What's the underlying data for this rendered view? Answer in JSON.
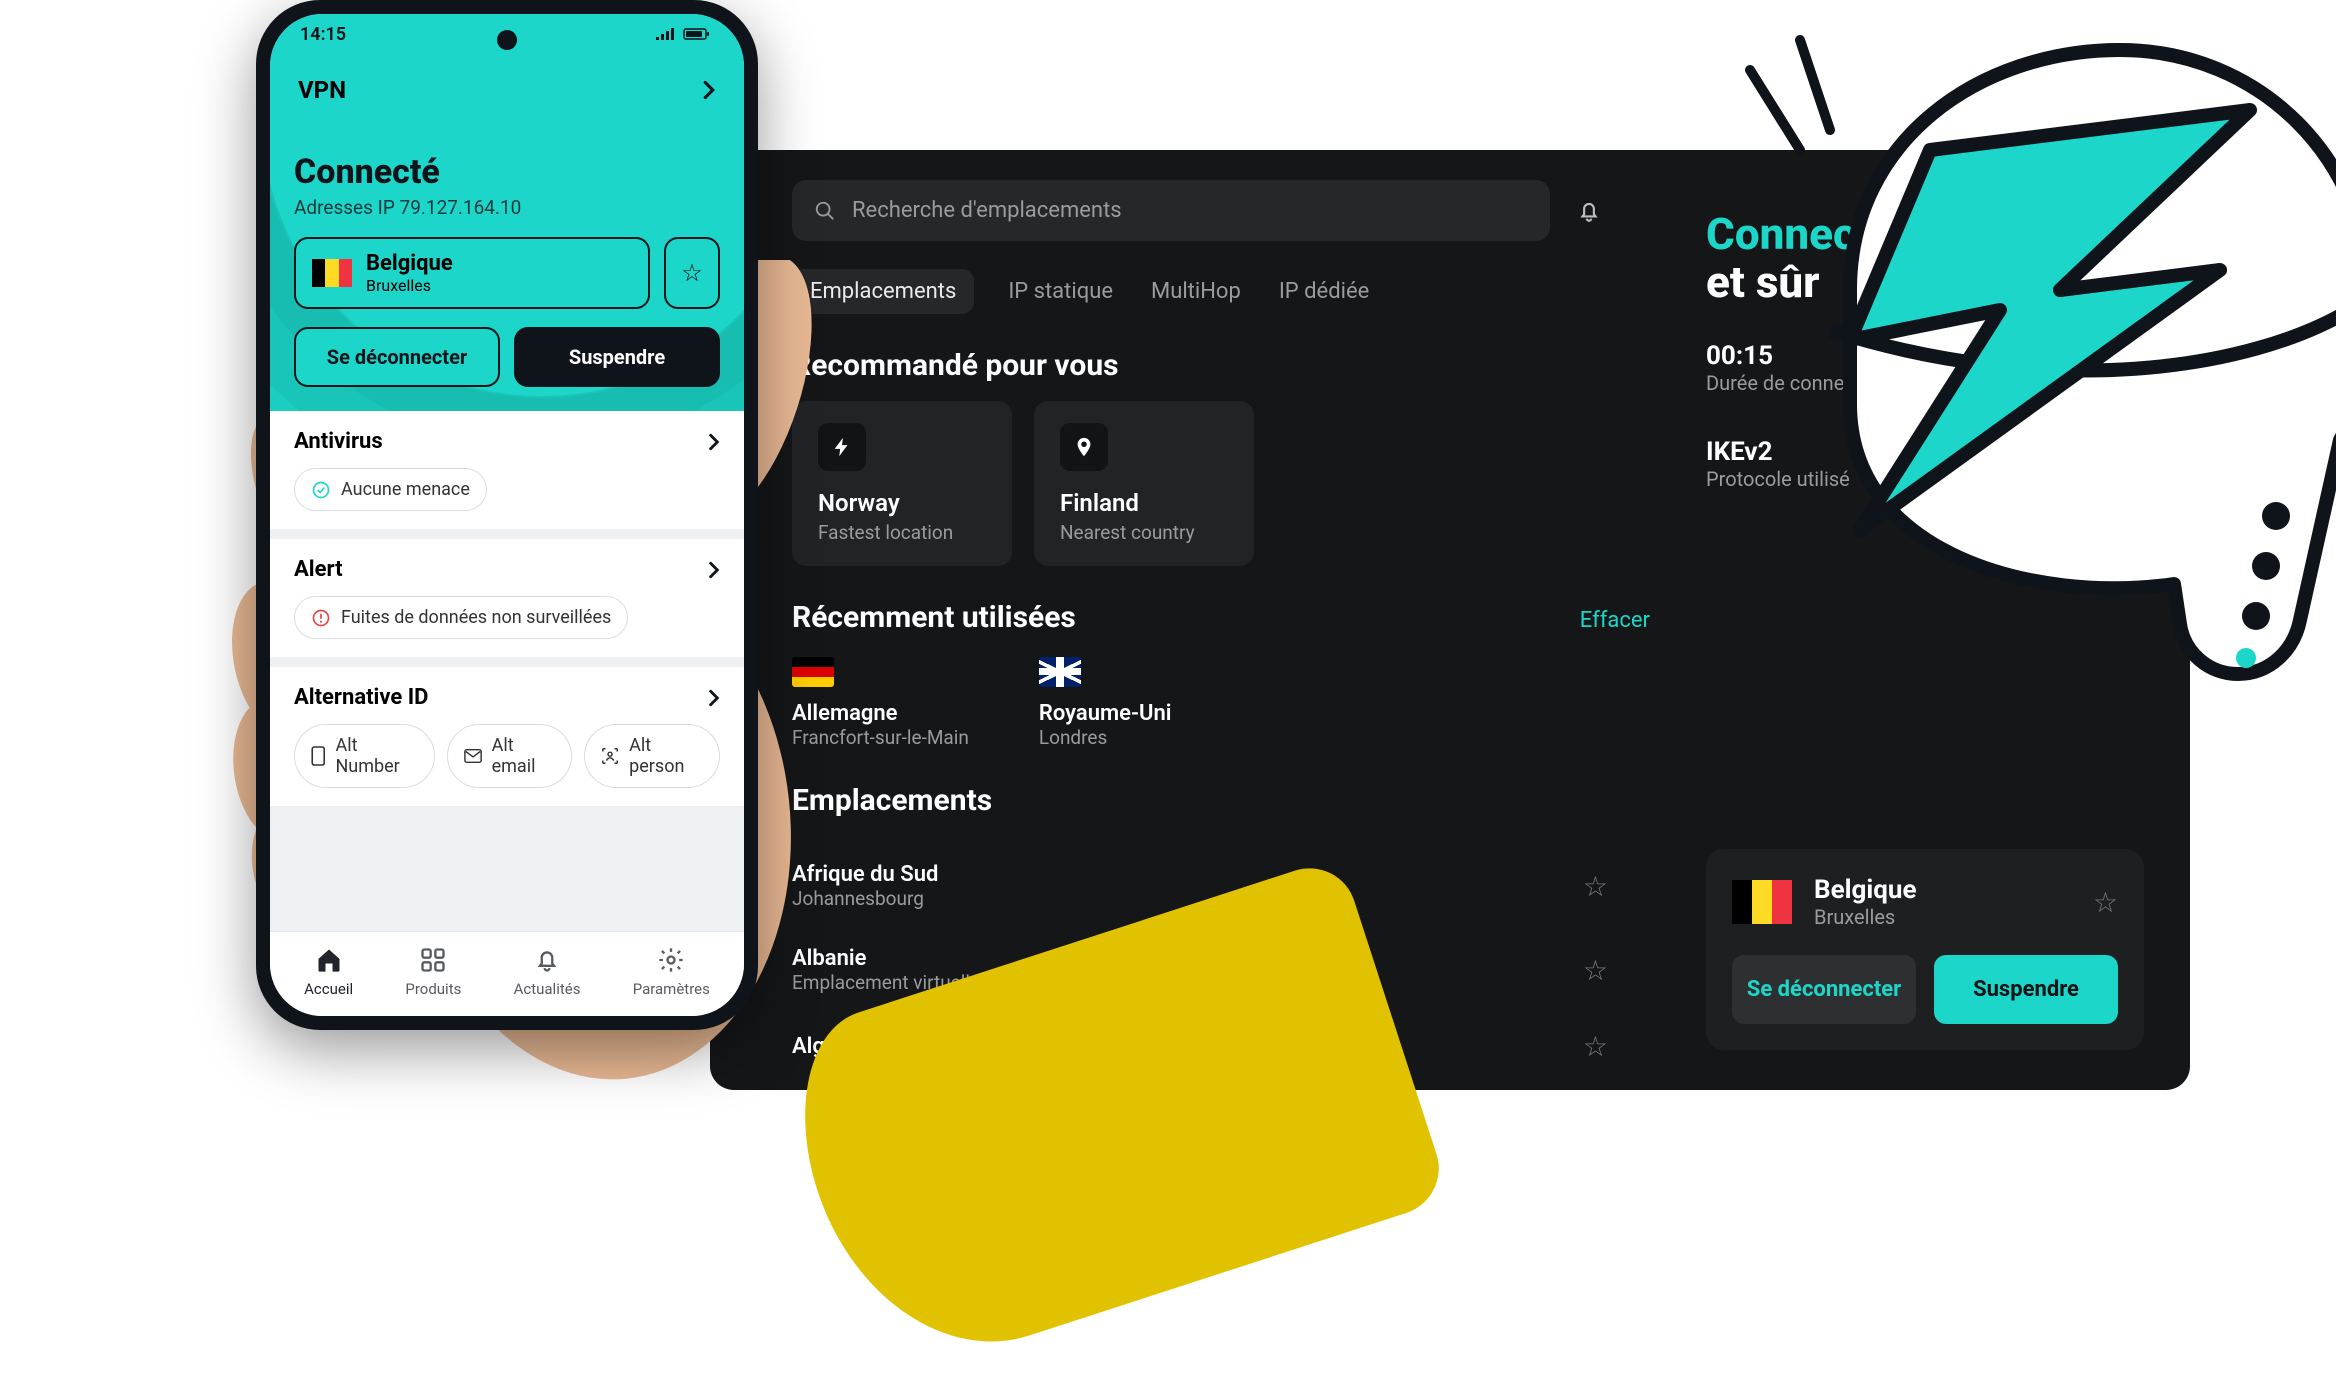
{
  "phone": {
    "time": "14:15",
    "app_selector": "VPN",
    "status": "Connecté",
    "ip_label": "Adresses IP 79.127.164.10",
    "server": {
      "country": "Belgique",
      "city": "Bruxelles"
    },
    "disconnect": "Se déconnecter",
    "suspend": "Suspendre",
    "sections": {
      "antivirus": {
        "title": "Antivirus",
        "status": "Aucune menace"
      },
      "alert": {
        "title": "Alert",
        "status": "Fuites de données non surveillées"
      },
      "altid": {
        "title": "Alternative ID",
        "pills": [
          "Alt Number",
          "Alt email",
          "Alt person"
        ]
      }
    },
    "tabs": [
      "Accueil",
      "Produits",
      "Actualités",
      "Paramètres"
    ]
  },
  "desktop": {
    "search_placeholder": "Recherche d'emplacements",
    "tabs": [
      "Emplacements",
      "IP statique",
      "MultiHop",
      "IP dédiée"
    ],
    "recommended_title": "Recommandé pour vous",
    "recommended": [
      {
        "title": "Norway",
        "sub": "Fastest location",
        "icon": "bolt"
      },
      {
        "title": "Finland",
        "sub": "Nearest country",
        "icon": "pin"
      }
    ],
    "recent_title": "Récemment utilisées",
    "clear": "Effacer",
    "recent": [
      {
        "country": "Allemagne",
        "city": "Francfort-sur-le-Main",
        "flag": "de"
      },
      {
        "country": "Royaume-Uni",
        "city": "Londres",
        "flag": "uk"
      }
    ],
    "locations_title": "Emplacements",
    "locations": [
      {
        "name": "Afrique du Sud",
        "sub": "Johannesbourg"
      },
      {
        "name": "Albanie",
        "sub": "Emplacement virtuelle"
      },
      {
        "name": "Algérie",
        "sub": ""
      }
    ],
    "status": {
      "line1": "Connecté",
      "line2": "et sûr",
      "duration_val": "00:15",
      "duration_lab": "Durée de connexion",
      "proto_val": "IKEv2",
      "proto_lab": "Protocole utilisé",
      "server": {
        "country": "Belgique",
        "city": "Bruxelles"
      },
      "disconnect": "Se déconnecter",
      "suspend": "Suspendre"
    }
  }
}
